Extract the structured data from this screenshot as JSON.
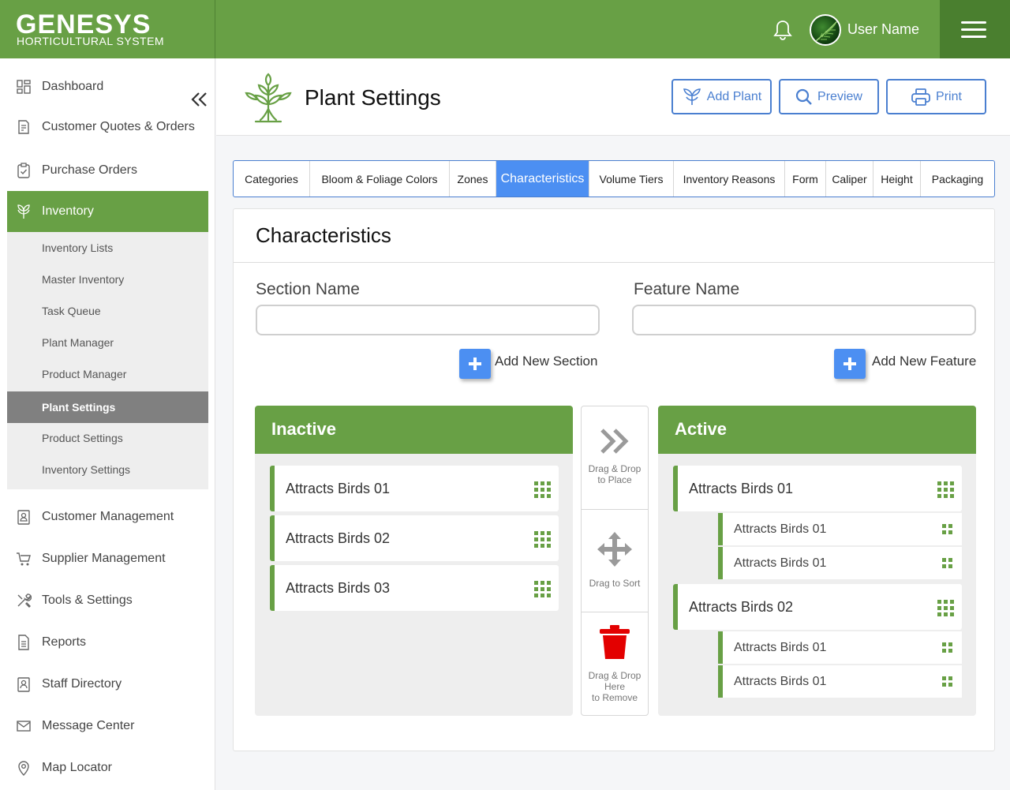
{
  "brand": {
    "name": "GENESYS",
    "tagline": "HORTICULTURAL SYSTEM"
  },
  "topbar": {
    "user_name": "User Name"
  },
  "sidebar": {
    "items": [
      {
        "label": "Dashboard",
        "icon": "dashboard-icon"
      },
      {
        "label": "Customer Quotes & Orders",
        "icon": "quotes-icon"
      },
      {
        "label": "Purchase Orders",
        "icon": "clipboard-icon"
      },
      {
        "label": "Inventory",
        "icon": "plant-icon"
      },
      {
        "label": "Customer Management",
        "icon": "contact-icon"
      },
      {
        "label": "Supplier Management",
        "icon": "cart-icon"
      },
      {
        "label": "Tools & Settings",
        "icon": "tools-icon"
      },
      {
        "label": "Reports",
        "icon": "report-icon"
      },
      {
        "label": "Staff Directory",
        "icon": "staff-icon"
      },
      {
        "label": "Message Center",
        "icon": "mail-icon"
      },
      {
        "label": "Map Locator",
        "icon": "map-pin-icon"
      }
    ],
    "inventory_sub": [
      "Inventory Lists",
      "Master Inventory",
      "Task Queue",
      "Plant Manager",
      "Product Manager",
      "Plant Settings",
      "Product Settings",
      "Inventory Settings"
    ],
    "active_sub": "Plant Settings"
  },
  "header": {
    "title": "Plant Settings",
    "add_plant": "Add Plant",
    "preview": "Preview",
    "print": "Print"
  },
  "tabs": [
    "Categories",
    "Bloom & Foliage Colors",
    "Zones",
    "Characteristics",
    "Volume Tiers",
    "Inventory Reasons",
    "Form",
    "Caliper",
    "Height",
    "Packaging"
  ],
  "active_tab": "Characteristics",
  "card": {
    "title": "Characteristics",
    "section_label": "Section Name",
    "feature_label": "Feature Name",
    "section_value": "",
    "feature_value": "",
    "add_section": "Add New Section",
    "add_feature": "Add New Feature"
  },
  "inactive": {
    "title": "Inactive",
    "items": [
      "Attracts Birds 01",
      "Attracts Birds 02",
      "Attracts Birds 03"
    ]
  },
  "middle": {
    "place": [
      "Drag & Drop",
      "to Place"
    ],
    "sort": "Drag to Sort",
    "remove": [
      "Drag & Drop",
      "Here",
      "to Remove"
    ]
  },
  "active": {
    "title": "Active",
    "groups": [
      {
        "label": "Attracts Birds 01",
        "children": [
          "Attracts Birds 01",
          "Attracts Birds 01"
        ]
      },
      {
        "label": "Attracts Birds 02",
        "children": [
          "Attracts Birds 01",
          "Attracts Birds 01"
        ]
      }
    ]
  },
  "colors": {
    "brand_green": "#68a045",
    "accent_blue": "#4c8ff2",
    "delete_red": "#e30000"
  }
}
